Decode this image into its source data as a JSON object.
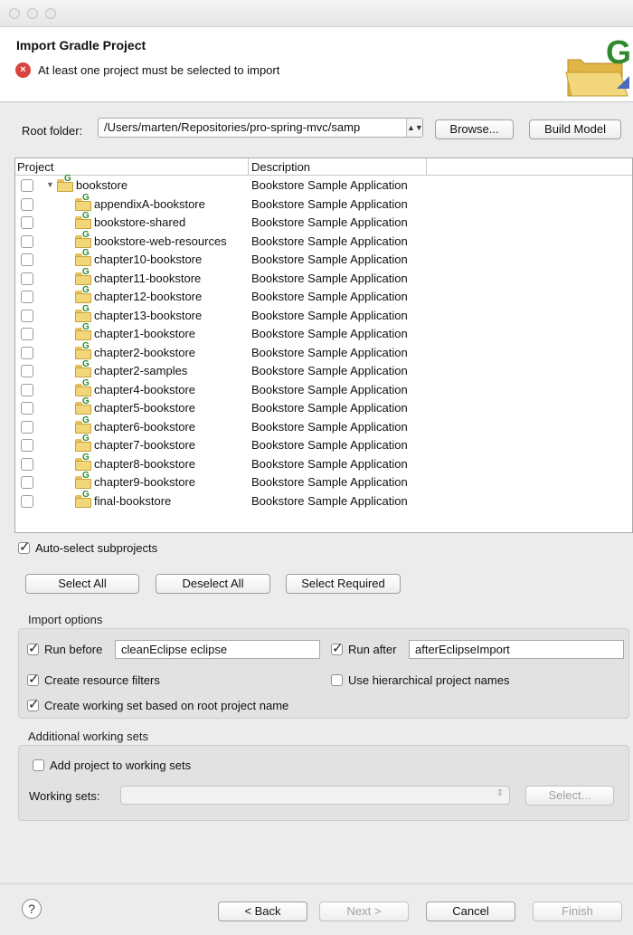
{
  "header": {
    "title": "Import Gradle Project",
    "error_message": "At least one project must be selected to import",
    "error_icon": "error-icon"
  },
  "root": {
    "label": "Root folder:",
    "value": "/Users/marten/Repositories/pro-spring-mvc/samp",
    "browse": "Browse...",
    "build_model": "Build Model"
  },
  "table": {
    "columns": [
      "Project",
      "Description"
    ],
    "root_project": {
      "name": "bookstore",
      "description": "Bookstore Sample Application"
    },
    "children": [
      {
        "name": "appendixA-bookstore",
        "description": "Bookstore Sample Application"
      },
      {
        "name": "bookstore-shared",
        "description": "Bookstore Sample Application"
      },
      {
        "name": "bookstore-web-resources",
        "description": "Bookstore Sample Application"
      },
      {
        "name": "chapter10-bookstore",
        "description": "Bookstore Sample Application"
      },
      {
        "name": "chapter11-bookstore",
        "description": "Bookstore Sample Application"
      },
      {
        "name": "chapter12-bookstore",
        "description": "Bookstore Sample Application"
      },
      {
        "name": "chapter13-bookstore",
        "description": "Bookstore Sample Application"
      },
      {
        "name": "chapter1-bookstore",
        "description": "Bookstore Sample Application"
      },
      {
        "name": "chapter2-bookstore",
        "description": "Bookstore Sample Application"
      },
      {
        "name": "chapter2-samples",
        "description": "Bookstore Sample Application"
      },
      {
        "name": "chapter4-bookstore",
        "description": "Bookstore Sample Application"
      },
      {
        "name": "chapter5-bookstore",
        "description": "Bookstore Sample Application"
      },
      {
        "name": "chapter6-bookstore",
        "description": "Bookstore Sample Application"
      },
      {
        "name": "chapter7-bookstore",
        "description": "Bookstore Sample Application"
      },
      {
        "name": "chapter8-bookstore",
        "description": "Bookstore Sample Application"
      },
      {
        "name": "chapter9-bookstore",
        "description": "Bookstore Sample Application"
      },
      {
        "name": "final-bookstore",
        "description": "Bookstore Sample Application"
      }
    ]
  },
  "auto_select": {
    "label": "Auto-select subprojects",
    "checked": true
  },
  "selection_buttons": {
    "select_all": "Select All",
    "deselect_all": "Deselect All",
    "select_required": "Select Required"
  },
  "import_options": {
    "title": "Import options",
    "run_before_label": "Run before",
    "run_before_value": "cleanEclipse eclipse",
    "run_after_label": "Run after",
    "run_after_value": "afterEclipseImport",
    "create_resource_filters": "Create resource filters",
    "use_hierarchical_names": "Use hierarchical project names",
    "create_working_set": "Create working set based on root project name"
  },
  "working_sets": {
    "title": "Additional working sets",
    "add_to_working_sets": "Add project to working sets",
    "label": "Working sets:",
    "select_button": "Select..."
  },
  "footer": {
    "back": "< Back",
    "next": "Next >",
    "cancel": "Cancel",
    "finish": "Finish",
    "help_icon": "help-icon"
  },
  "colors": {
    "window_bg": "#ececec",
    "header_bg": "#ffffff",
    "error_red": "#d9443f",
    "gradle_green": "#2f8a2f",
    "folder_yellow": "#f2d77a"
  }
}
